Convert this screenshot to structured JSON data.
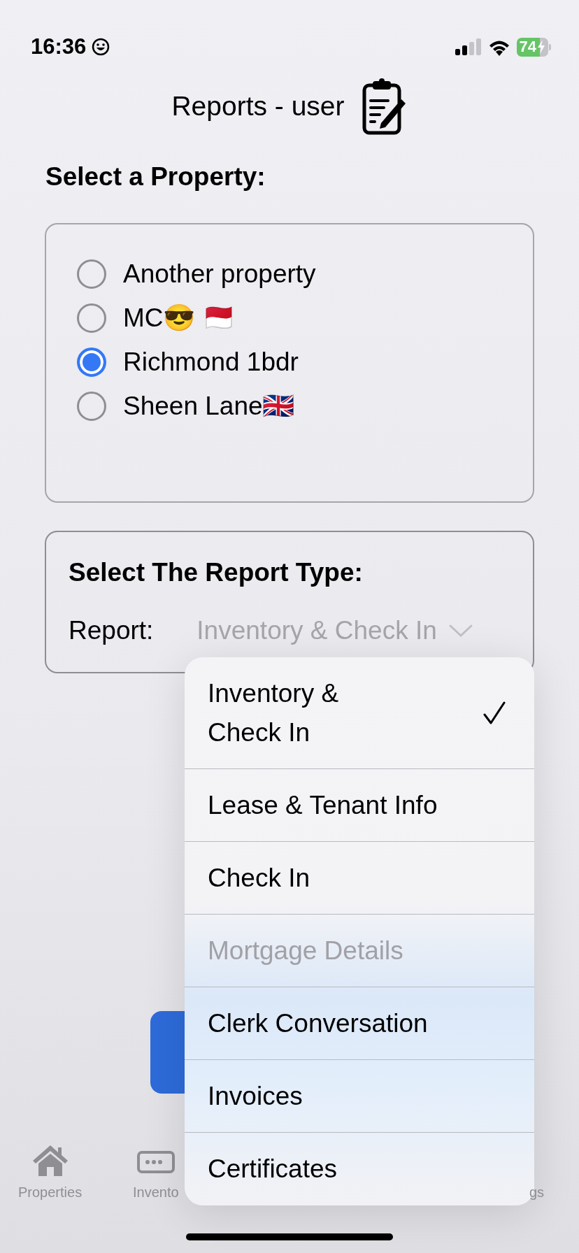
{
  "status_bar": {
    "time": "16:36",
    "battery": "74"
  },
  "header": {
    "title": "Reports - user"
  },
  "property_section": {
    "heading": "Select a Property:",
    "options": [
      {
        "label": "Another property",
        "selected": false
      },
      {
        "label": "MC😎 🇲🇨",
        "selected": false
      },
      {
        "label": "Richmond 1bdr",
        "selected": true
      },
      {
        "label": "Sheen Lane🇬🇧",
        "selected": false
      }
    ]
  },
  "report_section": {
    "heading": "Select The Report Type:",
    "label": "Report:",
    "value": "Inventory & Check In"
  },
  "report_menu": [
    {
      "label": "Inventory & Check In",
      "selected": true,
      "disabled": false
    },
    {
      "label": "Lease & Tenant Info",
      "selected": false,
      "disabled": false
    },
    {
      "label": "Check In",
      "selected": false,
      "disabled": false
    },
    {
      "label": "Mortgage Details",
      "selected": false,
      "disabled": true
    },
    {
      "label": "Clerk Conversation",
      "selected": false,
      "disabled": false
    },
    {
      "label": "Invoices",
      "selected": false,
      "disabled": false
    },
    {
      "label": "Certificates",
      "selected": false,
      "disabled": false
    }
  ],
  "tab_bar": [
    {
      "label": "Properties",
      "kind": "house"
    },
    {
      "label": "Invento",
      "kind": "keyboard"
    },
    {
      "label": "gs",
      "kind": "hidden"
    }
  ]
}
